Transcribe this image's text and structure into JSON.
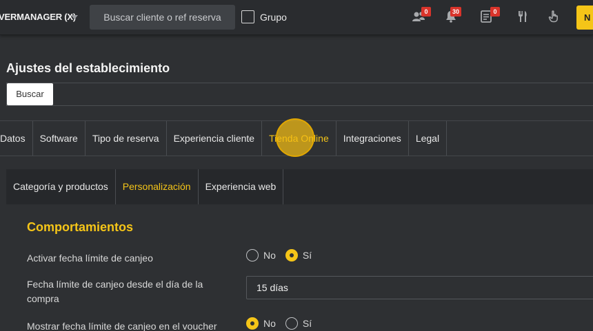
{
  "topbar": {
    "venue_name": "VERMANAGER (X)",
    "search_placeholder": "Buscar cliente o ref reserva",
    "group_label": "Grupo",
    "badges": {
      "clients": "0",
      "notifications": "30",
      "orders": "0"
    },
    "new_label": "N"
  },
  "page": {
    "title": "Ajustes del establecimiento",
    "search_button": "Buscar"
  },
  "main_tabs": [
    "Datos",
    "Software",
    "Tipo de reserva",
    "Experiencia cliente",
    "Tienda Online",
    "Integraciones",
    "Legal"
  ],
  "sub_tabs": [
    "Categoría y productos",
    "Personalización",
    "Experiencia web"
  ],
  "content": {
    "section_title": "Comportamientos",
    "field1": {
      "label": "Activar fecha límite de canjeo",
      "option_no": "No",
      "option_yes": "Sí",
      "selected": "Sí"
    },
    "field2": {
      "label": "Fecha límite de canjeo desde el día de la compra",
      "value": "15 días"
    },
    "field3": {
      "label": "Mostrar fecha límite de canjeo en el voucher",
      "option_no": "No",
      "option_yes": "Sí",
      "selected": "No"
    }
  },
  "colors": {
    "accent": "#f5c518",
    "badge": "#d9342b",
    "background": "#2e3033"
  },
  "icons": [
    "caret-down-icon",
    "users-icon",
    "bell-icon",
    "receipt-icon",
    "cutlery-icon",
    "hand-pointer-icon"
  ]
}
